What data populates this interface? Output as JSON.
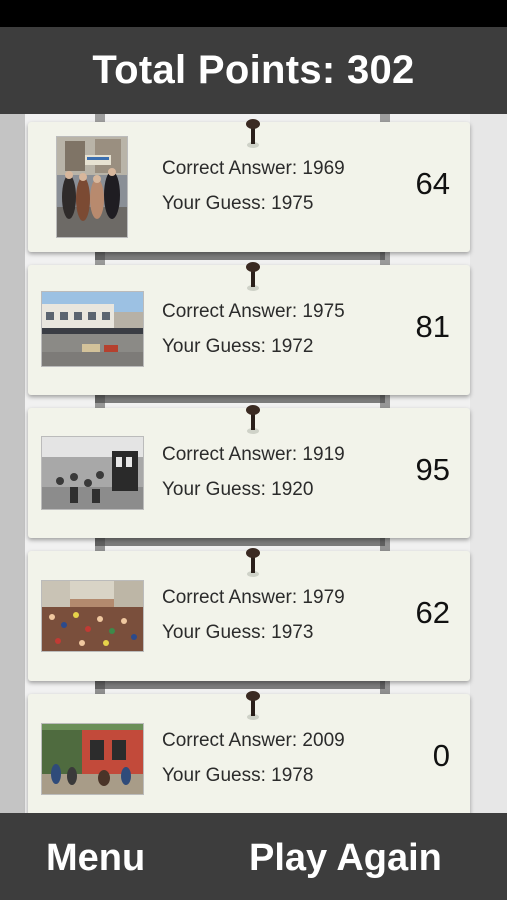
{
  "header": {
    "title": "Total Points: 302"
  },
  "results": [
    {
      "correct": "Correct Answer: 1969",
      "guess": "Your Guess: 1975",
      "points": "64",
      "photo": "street-crowd-photo"
    },
    {
      "correct": "Correct Answer: 1975",
      "guess": "Your Guess: 1972",
      "points": "81",
      "photo": "storefront-photo"
    },
    {
      "correct": "Correct Answer: 1919",
      "guess": "Your Guess: 1920",
      "points": "95",
      "photo": "beach-bathers-photo"
    },
    {
      "correct": "Correct Answer: 1979",
      "guess": "Your Guess: 1973",
      "points": "62",
      "photo": "parade-crowd-photo"
    },
    {
      "correct": "Correct Answer: 2009",
      "guess": "Your Guess: 1978",
      "points": "0",
      "photo": "cafe-street-photo"
    }
  ],
  "footer": {
    "menu_label": "Menu",
    "play_again_label": "Play Again"
  },
  "colors": {
    "bar": "#3d3d3d",
    "card": "#f2f3ea",
    "text": "#2b2b2b"
  }
}
